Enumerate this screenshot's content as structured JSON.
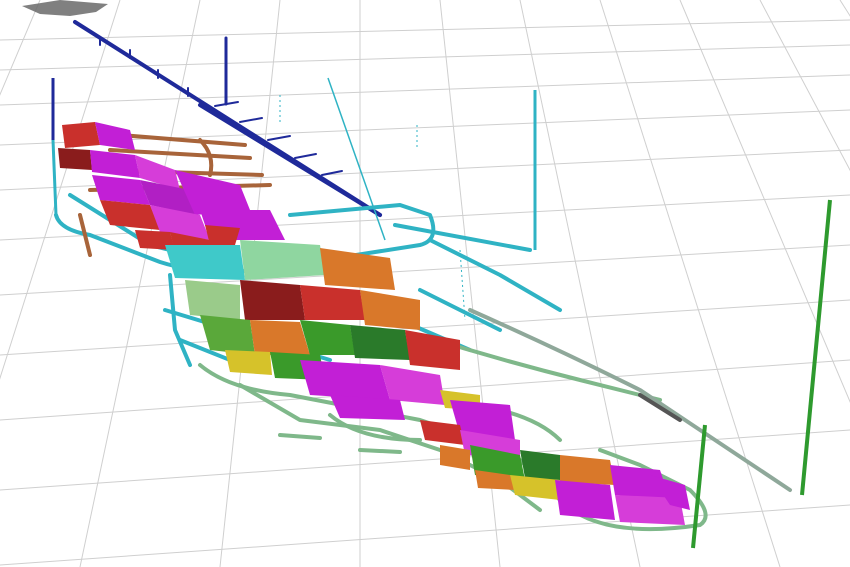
{
  "scene": {
    "kind": "3d-underground-mine-model",
    "colors": {
      "background": "#ffffff",
      "grid": "#c8c8c8",
      "decline_ramp": "#1f2a9a",
      "upper_drives": "#2fb3c4",
      "lower_drives": "#6fae7f",
      "vertical_shafts_left": "#2fb3c4",
      "vertical_shaft_right": "#2e9a2e",
      "stope_magenta": "#c21fd6",
      "stope_red": "#c9302c",
      "stope_orange": "#d9782a",
      "stope_green": "#3a9a2a",
      "stope_yellow": "#d6c22a",
      "stope_cyan": "#3fc9c9",
      "surface_topo": "#6a6a6a"
    }
  }
}
